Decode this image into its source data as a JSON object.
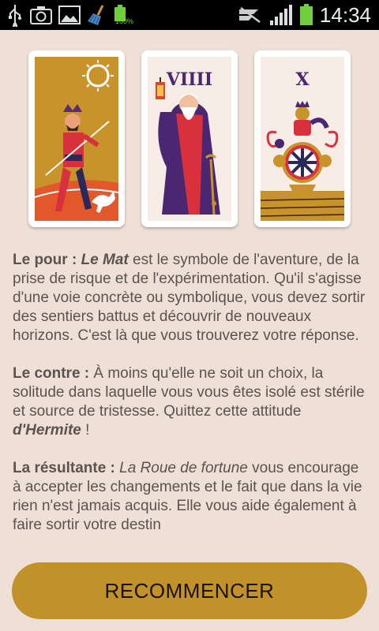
{
  "status_bar": {
    "time": "14:34",
    "battery_label": "100%",
    "icons": [
      "usb-icon",
      "camera-icon",
      "gallery-icon",
      "broom-icon",
      "battery-small-icon",
      "mute-icon",
      "signal-icon",
      "battery-icon"
    ]
  },
  "cards": [
    {
      "name": "Le Mat",
      "numeral": ""
    },
    {
      "name": "l'Hermite",
      "numeral": "VIIII"
    },
    {
      "name": "La Roue de fortune",
      "numeral": "X"
    }
  ],
  "content": {
    "p1": {
      "label": "Le pour :",
      "emph": "Le Mat",
      "text": " est le symbole de l'aventure, de la prise de risque et de l'expérimentation. Qu'il s'agisse d'une voie concrète ou symbolique, vous devez sortir des sentiers battus et découvrir de nouveaux horizons. C'est là que vous trouverez votre réponse."
    },
    "p2": {
      "label": "Le contre :",
      "text": " À moins qu'elle ne soit un choix, la solitude dans laquelle vous vous êtes isolé est stérile et source de tristesse. Quittez cette attitude ",
      "emph": "d'Hermite",
      "end": " !"
    },
    "p3": {
      "label": "La résultante :",
      "emph": "La Roue de fortune",
      "text": " vous encourage à accepter les changements et le fait que dans la vie rien n'est jamais acquis. Elle vous aide également à faire sortir votre destin"
    }
  },
  "button": {
    "label": "RECOMMENCER"
  },
  "colors": {
    "background": "#eee0d6",
    "button": "#c2922a",
    "text": "#5a5350"
  }
}
